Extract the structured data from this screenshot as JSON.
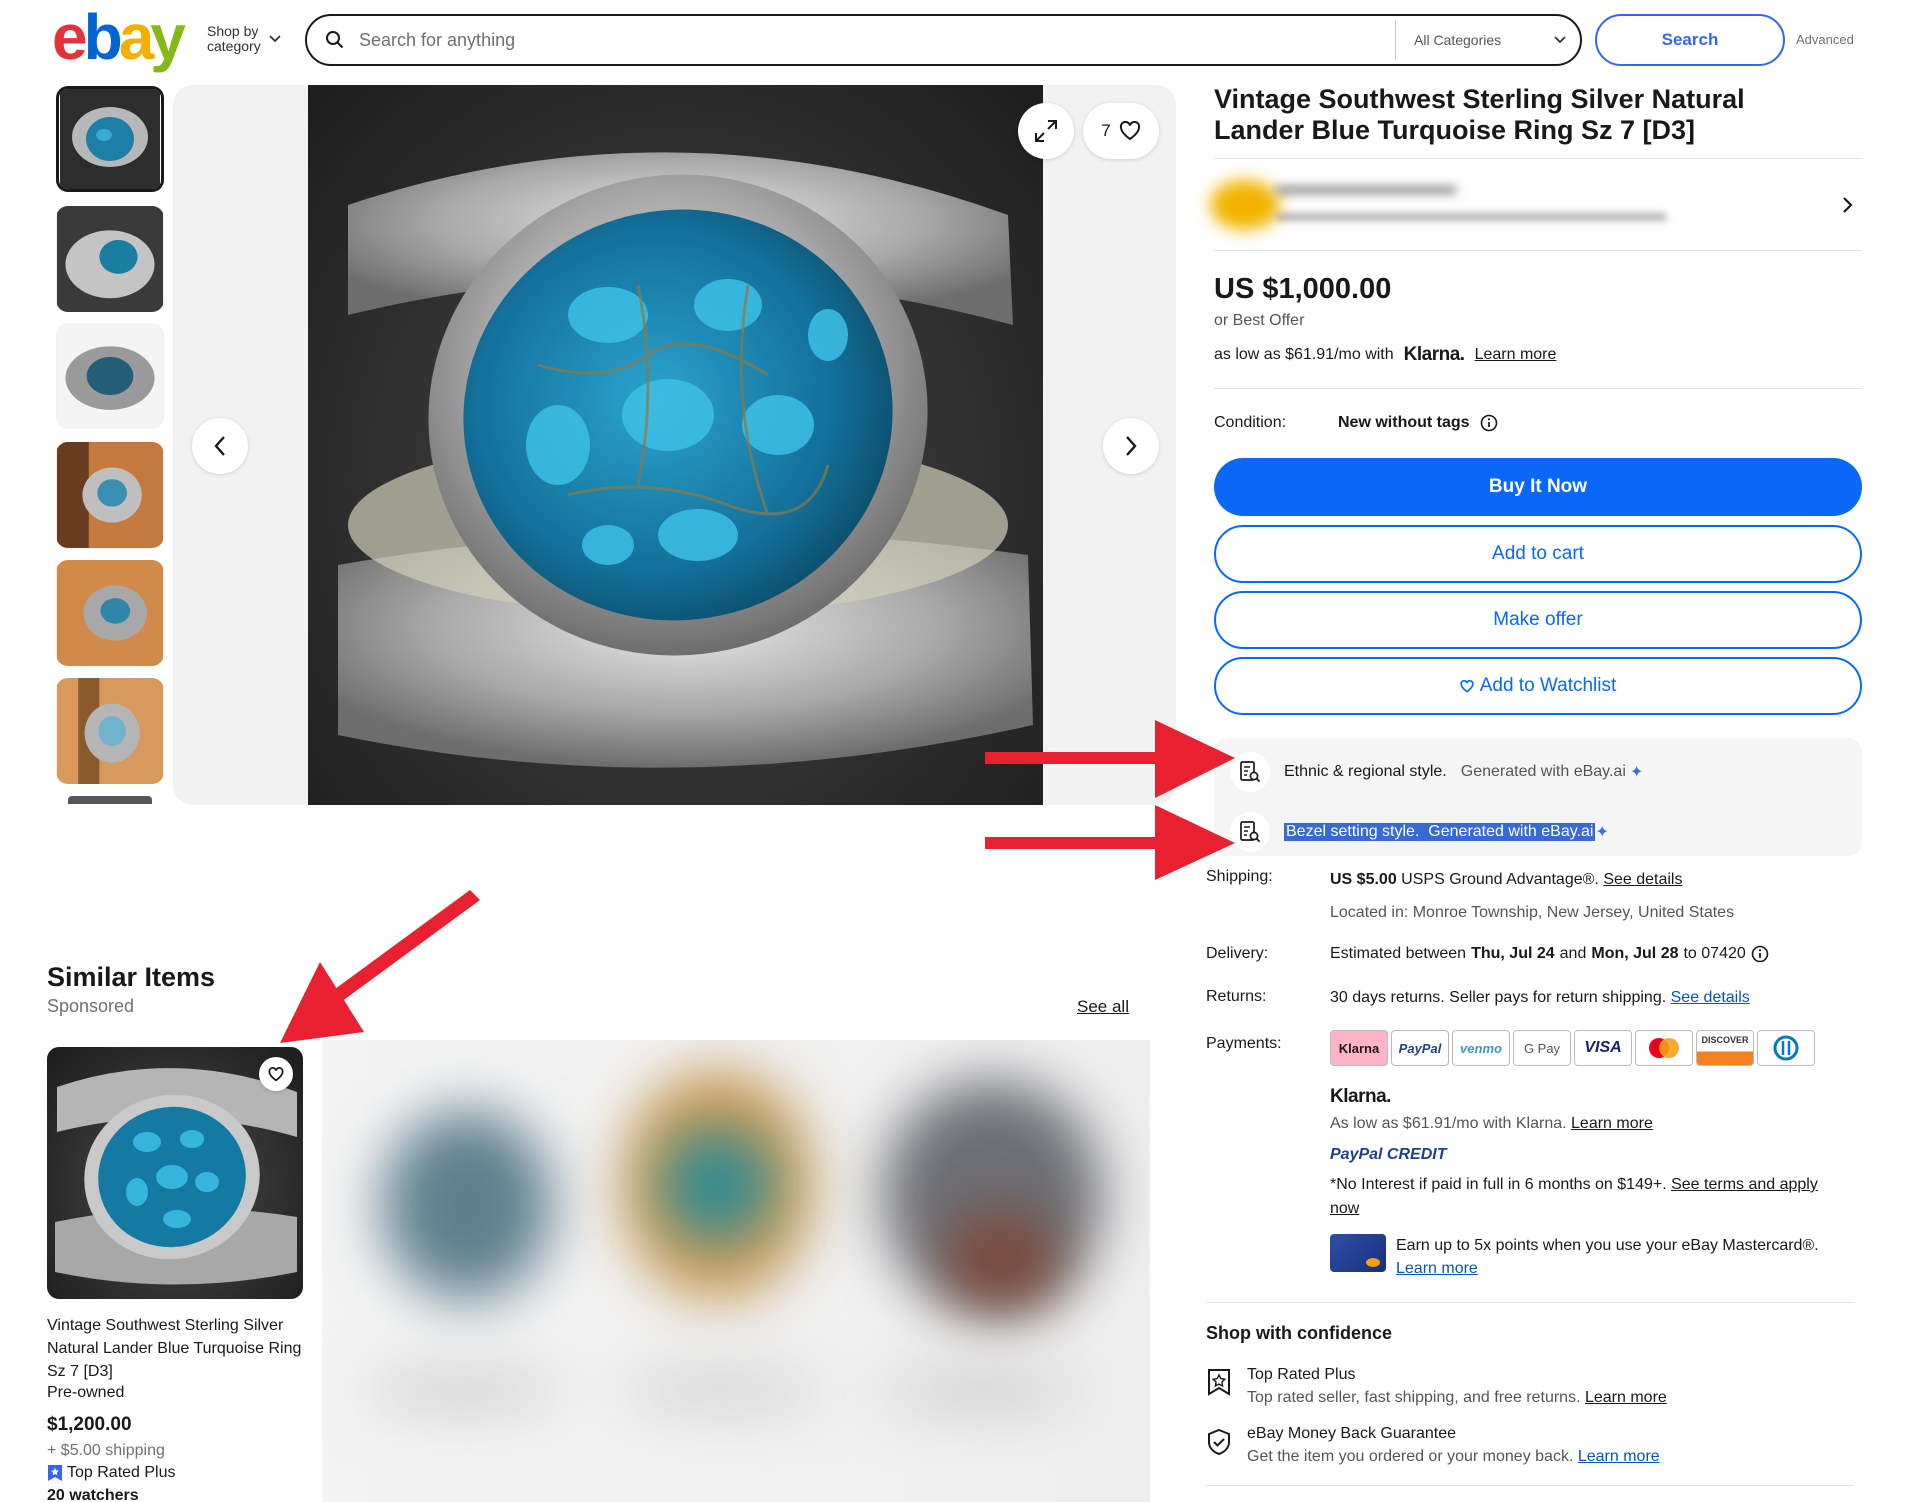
{
  "header": {
    "logo_letters": [
      "e",
      "b",
      "a",
      "y"
    ],
    "shop_by_line1": "Shop by",
    "shop_by_line2": "category",
    "search_placeholder": "Search for anything",
    "category": "All Categories",
    "search_button": "Search",
    "advanced": "Advanced"
  },
  "gallery": {
    "image_count": "7",
    "thumbnail_count": 6
  },
  "listing": {
    "title": "Vintage Southwest Sterling Silver Natural Lander Blue Turquoise Ring Sz 7 [D3]",
    "price": "US $1,000.00",
    "best_offer": "or Best Offer",
    "klarna_prefix": "as low as $61.91/mo with",
    "klarna_brand": "Klarna.",
    "klarna_link": "Learn more",
    "condition_label": "Condition:",
    "condition_value": "New without tags",
    "buy_now": "Buy It Now",
    "add_to_cart": "Add to cart",
    "make_offer": "Make offer",
    "watchlist": "Add to Watchlist",
    "ai_items": [
      {
        "text": "Ethnic & regional style.",
        "note": "Generated with eBay.ai"
      },
      {
        "text": "Bezel setting style.",
        "note": "Generated with eBay.ai"
      }
    ]
  },
  "details": {
    "shipping_label": "Shipping:",
    "shipping_price": "US $5.00",
    "shipping_service": "USPS Ground Advantage®.",
    "shipping_link": "See details",
    "located": "Located in: Monroe Township, New Jersey, United States",
    "delivery_label": "Delivery:",
    "delivery_pre": "Estimated between",
    "delivery_start": "Thu, Jul 24",
    "delivery_and": "and",
    "delivery_end": "Mon, Jul 28",
    "delivery_zip": "to 07420",
    "returns_label": "Returns:",
    "returns_text": "30 days returns. Seller pays for return shipping.",
    "returns_link": "See details",
    "payments_label": "Payments:",
    "payment_methods": [
      "Klarna",
      "PayPal",
      "venmo",
      "G Pay",
      "VISA",
      "Mastercard",
      "DISCOVER",
      "Diners"
    ],
    "klarna_heading": "Klarna.",
    "klarna_text": "As low as $61.91/mo with Klarna.",
    "klarna_learn": "Learn more",
    "paypal_credit": "PayPal CREDIT",
    "paypal_text": "*No Interest if paid in full in 6 months on $149+.",
    "paypal_link": "See terms and apply now",
    "mastercard_text": "Earn up to 5x points when you use your eBay Mastercard®.",
    "mastercard_link": "Learn more"
  },
  "confidence": {
    "heading": "Shop with confidence",
    "items": [
      {
        "title": "Top Rated Plus",
        "text": "Top rated seller, fast shipping, and free returns.",
        "link": "Learn more"
      },
      {
        "title": "eBay Money Back Guarantee",
        "text": "Get the item you ordered or your money back.",
        "link": "Learn more"
      }
    ]
  },
  "similar": {
    "title": "Similar Items",
    "sponsored": "Sponsored",
    "see_all": "See all",
    "card": {
      "title": "Vintage Southwest Sterling Silver Natural Lander Blue Turquoise Ring Sz 7 [D3]",
      "condition": "Pre-owned",
      "price": "$1,200.00",
      "shipping": "+ $5.00 shipping",
      "badge": "Top Rated Plus",
      "watchers": "20 watchers"
    }
  },
  "colors": {
    "ebay_red": "#e53238",
    "ebay_blue": "#0064d2",
    "ebay_yellow": "#f5af02",
    "ebay_green": "#86b817",
    "button_blue": "#0968f6",
    "annotation_arrow": "#e8202f",
    "highlight": "#3869d4"
  }
}
